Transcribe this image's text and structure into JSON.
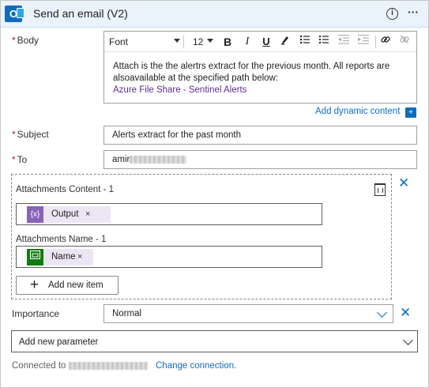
{
  "header": {
    "title": "Send an email (V2)",
    "app_icon": "outlook-icon",
    "info_icon": "info-icon",
    "more_icon": "more-options-icon"
  },
  "body_field": {
    "label": "Body",
    "required_mark": "*",
    "toolbar": {
      "font": "Font",
      "size": "12",
      "bold": "B",
      "italic": "I",
      "underline": "U"
    },
    "text": "Attach is the the alertrs extract for the previous month. All reports are alsoavailable at the specified path below:",
    "link_text": "Azure File Share - Sentinel Alerts"
  },
  "add_dynamic_content": "Add dynamic content",
  "subject_field": {
    "label": "Subject",
    "required_mark": "*",
    "value": "Alerts extract for the past month"
  },
  "to_field": {
    "label": "To",
    "required_mark": "*",
    "value_prefix": "amir"
  },
  "attachments": {
    "content_label": "Attachments Content - 1",
    "content_token": "Output",
    "name_label": "Attachments Name - 1",
    "name_token": "Name",
    "add_item": "Add new item",
    "token_remove": "×",
    "row_remove": "✕"
  },
  "importance": {
    "label": "Importance",
    "value": "Normal"
  },
  "add_parameter": "Add new parameter",
  "footer": {
    "connected_to": "Connected to",
    "change_connection": "Change connection."
  },
  "colors": {
    "accent": "#0f6cbd",
    "header_bg": "#eaf2fb",
    "required": "#a4262c",
    "token_bg": "#ece6f4",
    "link_purple": "#5c2d91",
    "output_icon": "#8764b8",
    "name_icon": "#107c10"
  }
}
